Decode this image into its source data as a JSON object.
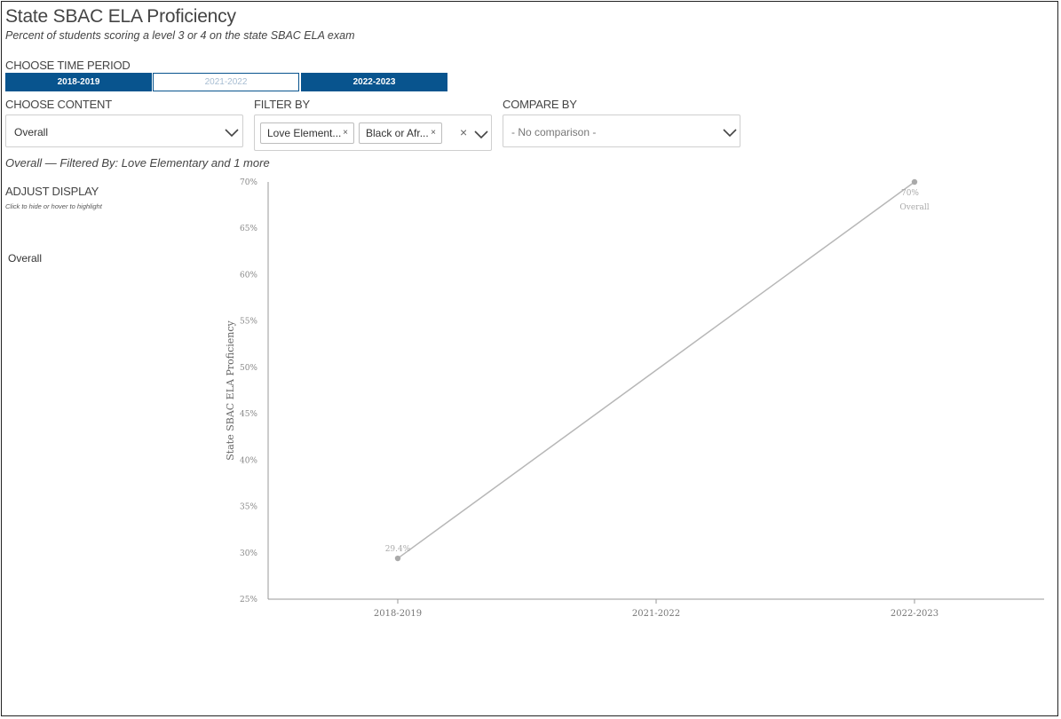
{
  "header": {
    "title": "State SBAC ELA Proficiency",
    "subtitle": "Percent of students scoring a level 3 or 4 on the state SBAC ELA exam"
  },
  "time_period": {
    "label": "CHOOSE TIME PERIOD",
    "options": [
      {
        "label": "2018-2019",
        "selected": true
      },
      {
        "label": "2021-2022",
        "selected": false
      },
      {
        "label": "2022-2023",
        "selected": true
      }
    ]
  },
  "content": {
    "label": "CHOOSE CONTENT",
    "value": "Overall"
  },
  "filter": {
    "label": "FILTER BY",
    "chips": [
      "Love Element...",
      "Black or Afr..."
    ],
    "chip_remove": "×",
    "clear": "×"
  },
  "compare": {
    "label": "COMPARE BY",
    "placeholder": "- No comparison -"
  },
  "filter_summary": "Overall — Filtered By: Love Elementary and 1 more",
  "adjust_display": {
    "label": "ADJUST DISPLAY",
    "hint": "Click to hide or hover to highlight",
    "legend": [
      "Overall"
    ]
  },
  "colors": {
    "accent": "#08548e",
    "series": "#b7b7b7",
    "axis": "#999999"
  },
  "chart_data": {
    "type": "line",
    "categories": [
      "2018-2019",
      "2021-2022",
      "2022-2023"
    ],
    "series": [
      {
        "name": "Overall",
        "values": [
          29.4,
          null,
          70
        ],
        "labels": [
          "29.4%",
          null,
          "70%"
        ]
      }
    ],
    "ylabel": "State SBAC ELA Proficiency",
    "ylim": [
      25,
      70
    ],
    "yticks": [
      70,
      65,
      60,
      55,
      50,
      45,
      40,
      35,
      30,
      25
    ],
    "ytick_labels": [
      "70%",
      "65%",
      "60%",
      "55%",
      "50%",
      "45%",
      "40%",
      "35%",
      "30%",
      "25%"
    ],
    "grid": false
  }
}
